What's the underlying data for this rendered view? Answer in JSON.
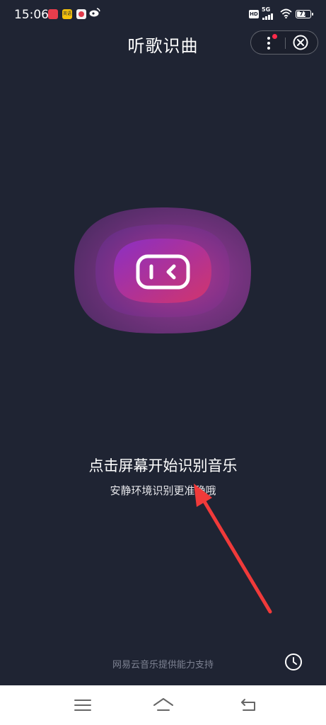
{
  "status_bar": {
    "time": "15:06",
    "notification_icons": [
      "notify-app-red-icon",
      "notify-app-yellow-icon",
      "notify-app-round-icon",
      "weibo-icon"
    ],
    "notification_labels": [
      "",
      "英语",
      "",
      ""
    ],
    "system_icons": [
      "hd-icon",
      "5g-signal-icon",
      "wifi-icon",
      "battery-icon"
    ],
    "hd_label": "HD",
    "network_label": "5G",
    "battery_level": 71,
    "battery_label": "71"
  },
  "header": {
    "title": "听歌识曲",
    "more_icon": "more-dots-icon",
    "close_icon": "close-circle-icon"
  },
  "main": {
    "logo_icon": "recognize-logo-icon",
    "instruction": "点击屏幕开始识别音乐",
    "tip": "安静环境识别更准确哦"
  },
  "footer": {
    "credit": "网易云音乐提供能力支持",
    "history_icon": "clock-history-icon"
  },
  "nav_bar": {
    "icons": [
      "menu-icon",
      "home-icon",
      "back-icon"
    ]
  },
  "colors": {
    "background": "#1f2433",
    "blob_outer": "#5c2a6e",
    "blob_inner": "#8a2fc4",
    "blob_accent": "#d2356c",
    "annotation_arrow": "#f03a3a",
    "nav_background": "#ffffff"
  }
}
